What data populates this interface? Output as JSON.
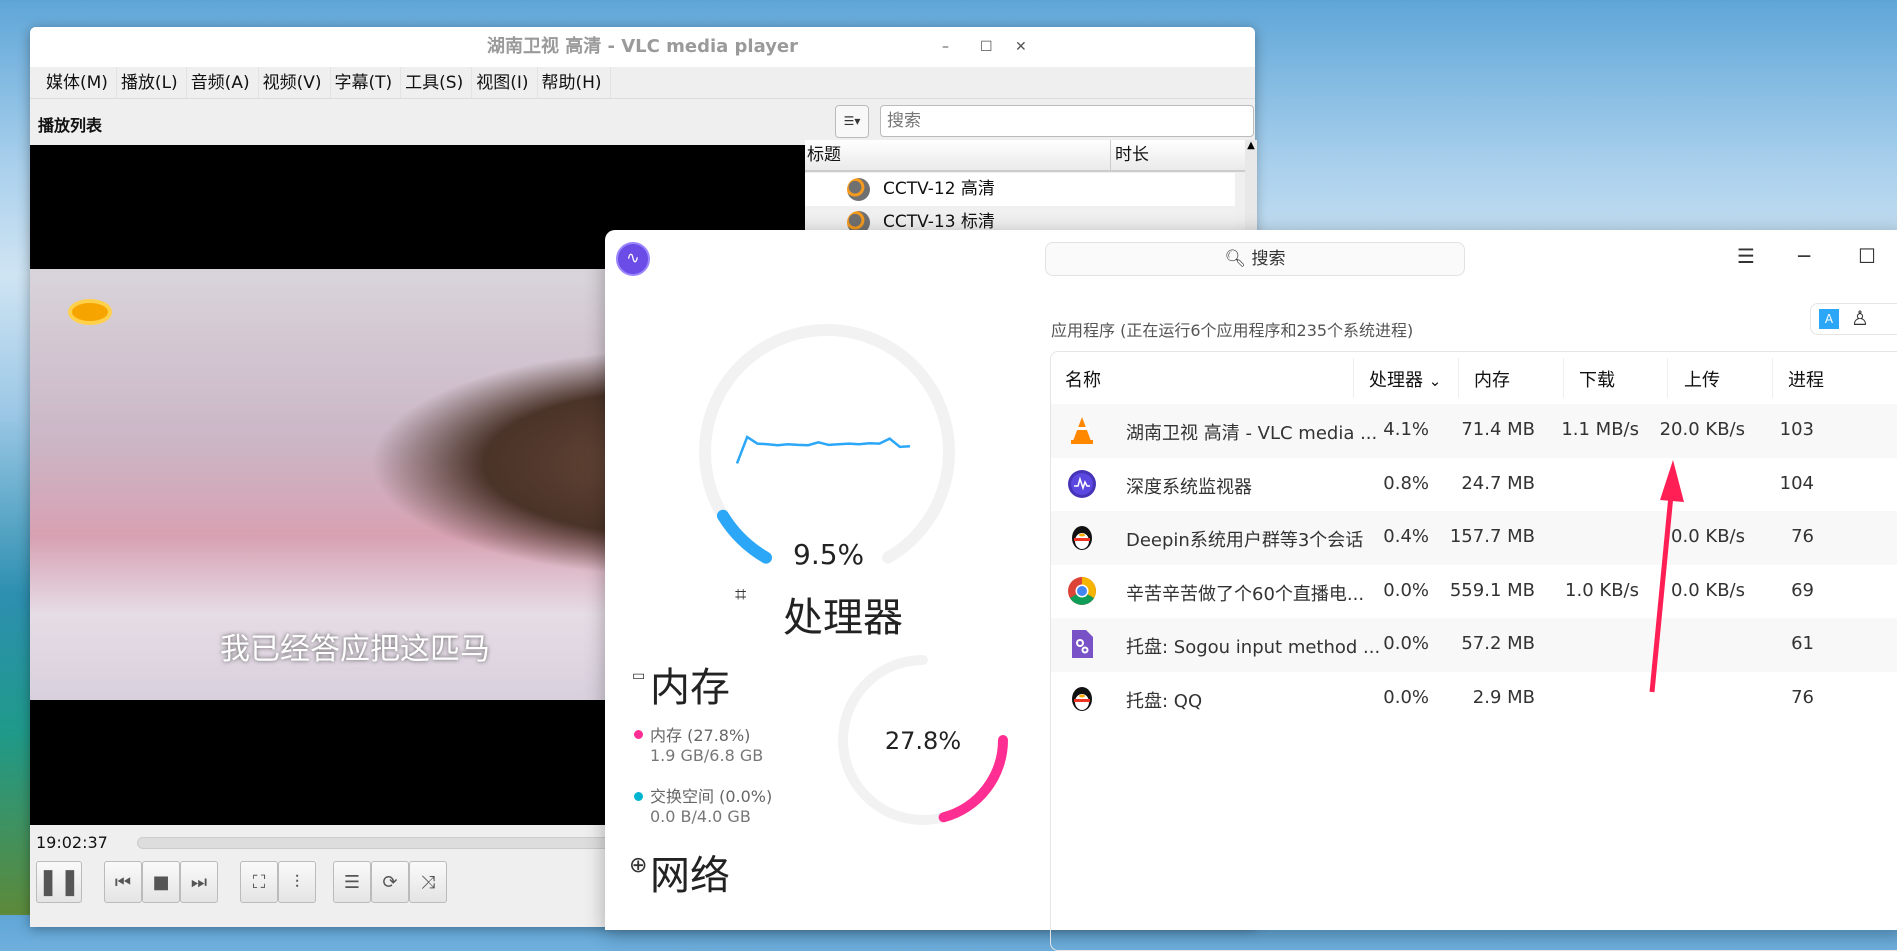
{
  "vlc": {
    "title": "湖南卫视 高清 - VLC media player",
    "menu": [
      "媒体(M)",
      "播放(L)",
      "音频(A)",
      "视频(V)",
      "字幕(T)",
      "工具(S)",
      "视图(I)",
      "帮助(H)"
    ],
    "playlist_label": "播放列表",
    "search_placeholder": "搜索",
    "columns": [
      "标题",
      "时长"
    ],
    "items": [
      "CCTV-12 高清",
      "CCTV-13 标清"
    ],
    "subtitle": "我已经答应把这匹马",
    "time": "19:02:37"
  },
  "monitor": {
    "search": "搜索",
    "cpu": {
      "percent": "9.5%",
      "label": "处理器",
      "value": 9.5,
      "history": [
        2,
        10,
        8,
        7.8,
        7.5,
        7.8,
        7.6,
        7.5,
        8.4,
        7.6,
        7.8,
        8,
        7.8,
        8.1,
        8,
        9.5,
        7,
        7.2
      ]
    },
    "memory": {
      "label": "内存",
      "percent": "27.8%",
      "value": 27.8,
      "mem_legend": "内存 (27.8%)",
      "mem_detail": "1.9 GB/6.8 GB",
      "swap_legend": "交换空间 (0.0%)",
      "swap_detail": "0.0 B/4.0 GB"
    },
    "network": {
      "label": "网络"
    },
    "app_header": "应用程序 (正在运行6个应用程序和235个系统进程)",
    "columns": [
      "名称",
      "处理器",
      "内存",
      "下载",
      "上传",
      "进程"
    ],
    "rows": [
      {
        "name": "湖南卫视 高清 - VLC media ...",
        "cpu": "4.1%",
        "mem": "71.4 MB",
        "down": "1.1 MB/s",
        "up": "20.0 KB/s",
        "pid": "103",
        "icon": "vlc-icon"
      },
      {
        "name": "深度系统监视器",
        "cpu": "0.8%",
        "mem": "24.7 MB",
        "down": "",
        "up": "",
        "pid": "104",
        "icon": "monitor-icon"
      },
      {
        "name": "Deepin系统用户群等3个会话",
        "cpu": "0.4%",
        "mem": "157.7 MB",
        "down": "",
        "up": "0.0 KB/s",
        "pid": "76",
        "icon": "qq-icon"
      },
      {
        "name": "辛苦辛苦做了个60个直播电...",
        "cpu": "0.0%",
        "mem": "559.1 MB",
        "down": "1.0 KB/s",
        "up": "0.0 KB/s",
        "pid": "69",
        "icon": "chrome-icon"
      },
      {
        "name": "托盘: Sogou input method ...",
        "cpu": "0.0%",
        "mem": "57.2 MB",
        "down": "",
        "up": "",
        "pid": "61",
        "icon": "sogou-icon"
      },
      {
        "name": "托盘: QQ",
        "cpu": "0.0%",
        "mem": "2.9 MB",
        "down": "",
        "up": "",
        "pid": "76",
        "icon": "qq-icon"
      }
    ],
    "colors": {
      "cpu": "#2ca7f8",
      "memory": "#ff2e93",
      "swap": "#00b5d0",
      "arrow": "#ff1f55"
    }
  }
}
